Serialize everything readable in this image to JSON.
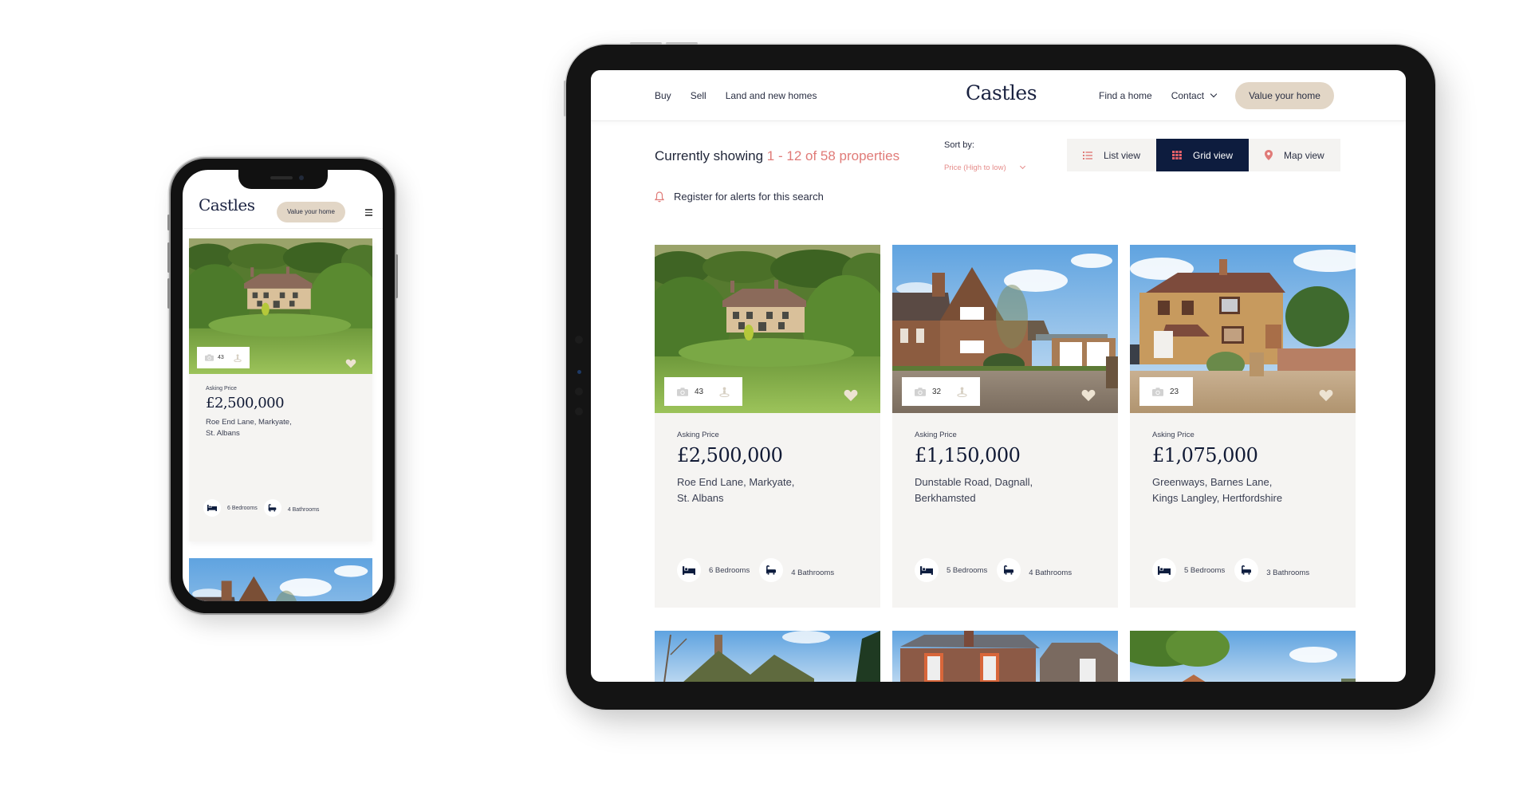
{
  "brand": {
    "name": "Castles",
    "colors": {
      "navy": "#0d1c3e",
      "accent_coral": "#e07b78",
      "beige_button": "#e2d6c6",
      "card_bg": "#f5f4f2"
    }
  },
  "tablet": {
    "nav_left": [
      {
        "label": "Buy"
      },
      {
        "label": "Sell"
      },
      {
        "label": "Land and new homes"
      }
    ],
    "nav_right": [
      {
        "label": "Find a home"
      },
      {
        "label": "Contact",
        "icon": "chevron-down-icon"
      }
    ],
    "cta_label": "Value your home",
    "results": {
      "prefix": "Currently showing",
      "range": "1 - 12 of 58 properties"
    },
    "alert_label": "Register for alerts for this search",
    "sort": {
      "label": "Sort by:",
      "selected": "Price (High to low)"
    },
    "views": [
      {
        "label": "List view",
        "icon": "list-icon",
        "active": false
      },
      {
        "label": "Grid view",
        "icon": "grid-icon",
        "active": true
      },
      {
        "label": "Map view",
        "icon": "map-pin-icon",
        "active": false
      }
    ],
    "listings": [
      {
        "photo_count": "43",
        "has_tour": true,
        "price_label": "Asking Price",
        "price": "£2,500,000",
        "address_line1": "Roe End Lane, Markyate,",
        "address_line2": "St. Albans",
        "bedrooms": "6 Bedrooms",
        "bathrooms": "4 Bathrooms"
      },
      {
        "photo_count": "32",
        "has_tour": true,
        "price_label": "Asking Price",
        "price": "£1,150,000",
        "address_line1": "Dunstable Road, Dagnall,",
        "address_line2": "Berkhamsted",
        "bedrooms": "5 Bedrooms",
        "bathrooms": "4 Bathrooms"
      },
      {
        "photo_count": "23",
        "has_tour": false,
        "price_label": "Asking Price",
        "price": "£1,075,000",
        "address_line1": "Greenways, Barnes Lane,",
        "address_line2": "Kings Langley, Hertfordshire",
        "bedrooms": "5 Bedrooms",
        "bathrooms": "3 Bathrooms"
      }
    ]
  },
  "phone": {
    "cta_label": "Value your home",
    "listing": {
      "photo_count": "43",
      "price_label": "Asking Price",
      "price": "£2,500,000",
      "address_line1": "Roe End Lane, Markyate,",
      "address_line2": "St. Albans",
      "bedrooms": "6 Bedrooms",
      "bathrooms": "4 Bathrooms"
    }
  }
}
